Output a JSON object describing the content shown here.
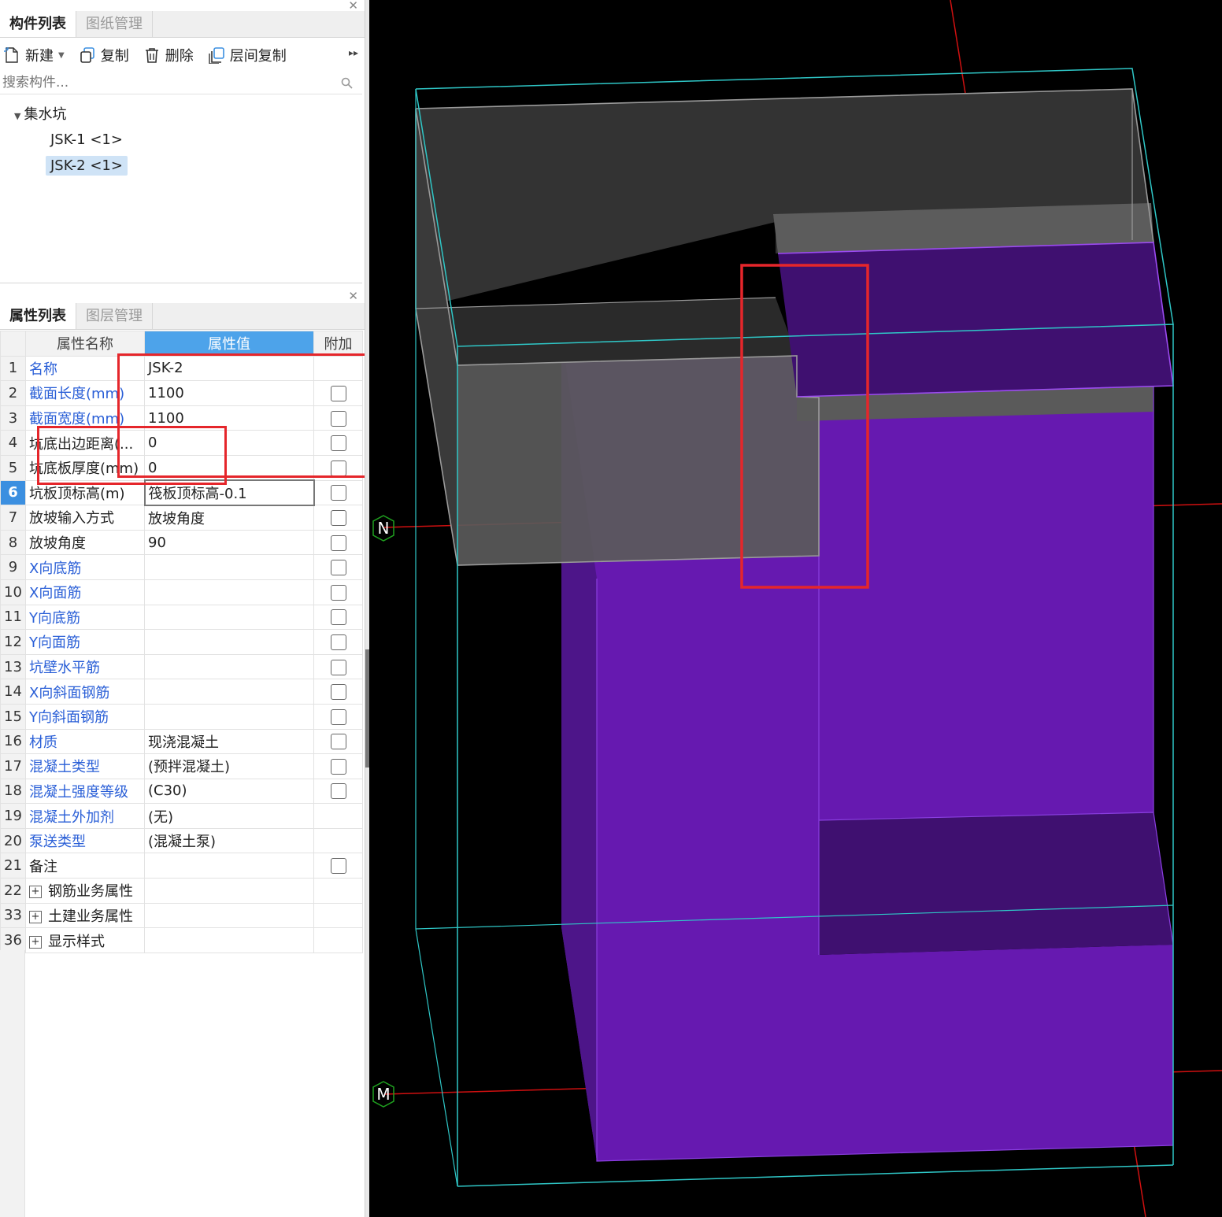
{
  "top_panel": {
    "tabs": [
      {
        "label": "构件列表",
        "active": true
      },
      {
        "label": "图纸管理",
        "active": false
      }
    ],
    "toolbar": [
      {
        "label": "新建",
        "icon": "new-file-icon",
        "has_dropdown": true
      },
      {
        "label": "复制",
        "icon": "copy-icon"
      },
      {
        "label": "删除",
        "icon": "trash-icon"
      },
      {
        "label": "层间复制",
        "icon": "layer-copy-icon"
      }
    ],
    "search_placeholder": "搜索构件...",
    "tree": {
      "category": "集水坑",
      "items": [
        {
          "label": "JSK-1 <1>",
          "selected": false
        },
        {
          "label": "JSK-2 <1>",
          "selected": true
        }
      ]
    }
  },
  "bottom_panel": {
    "tabs": [
      {
        "label": "属性列表",
        "active": true
      },
      {
        "label": "图层管理",
        "active": false
      }
    ],
    "columns": [
      "属性名称",
      "属性值",
      "附加"
    ],
    "rows": [
      {
        "num": "1",
        "name": "名称",
        "value": "JSK-2",
        "blue": true,
        "checkbox": false
      },
      {
        "num": "2",
        "name": "截面长度(mm)",
        "value": "1100",
        "blue": true,
        "checkbox": true
      },
      {
        "num": "3",
        "name": "截面宽度(mm)",
        "value": "1100",
        "blue": true,
        "checkbox": true
      },
      {
        "num": "4",
        "name": "坑底出边距离(...",
        "value": "0",
        "blue": false,
        "checkbox": true
      },
      {
        "num": "5",
        "name": "坑底板厚度(mm)",
        "value": "0",
        "blue": false,
        "checkbox": true
      },
      {
        "num": "6",
        "name": "坑板顶标高(m)",
        "value": "筏板顶标高-0.1",
        "blue": false,
        "checkbox": true,
        "selected": true
      },
      {
        "num": "7",
        "name": "放坡输入方式",
        "value": "放坡角度",
        "blue": false,
        "checkbox": true
      },
      {
        "num": "8",
        "name": "放坡角度",
        "value": "90",
        "blue": false,
        "checkbox": true
      },
      {
        "num": "9",
        "name": "X向底筋",
        "value": "",
        "blue": true,
        "checkbox": true
      },
      {
        "num": "10",
        "name": "X向面筋",
        "value": "",
        "blue": true,
        "checkbox": true
      },
      {
        "num": "11",
        "name": "Y向底筋",
        "value": "",
        "blue": true,
        "checkbox": true
      },
      {
        "num": "12",
        "name": "Y向面筋",
        "value": "",
        "blue": true,
        "checkbox": true
      },
      {
        "num": "13",
        "name": "坑壁水平筋",
        "value": "",
        "blue": true,
        "checkbox": true
      },
      {
        "num": "14",
        "name": "X向斜面钢筋",
        "value": "",
        "blue": true,
        "checkbox": true
      },
      {
        "num": "15",
        "name": "Y向斜面钢筋",
        "value": "",
        "blue": true,
        "checkbox": true
      },
      {
        "num": "16",
        "name": "材质",
        "value": "现浇混凝土",
        "blue": true,
        "checkbox": true
      },
      {
        "num": "17",
        "name": "混凝土类型",
        "value": "(预拌混凝土)",
        "blue": true,
        "checkbox": true
      },
      {
        "num": "18",
        "name": "混凝土强度等级",
        "value": "(C30)",
        "blue": true,
        "checkbox": true
      },
      {
        "num": "19",
        "name": "混凝土外加剂",
        "value": "(无)",
        "blue": true,
        "checkbox": false
      },
      {
        "num": "20",
        "name": "泵送类型",
        "value": "(混凝土泵)",
        "blue": true,
        "checkbox": false
      },
      {
        "num": "21",
        "name": "备注",
        "value": "",
        "blue": false,
        "checkbox": true
      },
      {
        "num": "22",
        "name": "钢筋业务属性",
        "value": "",
        "blue": false,
        "checkbox": false,
        "group": true
      },
      {
        "num": "33",
        "name": "土建业务属性",
        "value": "",
        "blue": false,
        "checkbox": false,
        "group": true
      },
      {
        "num": "36",
        "name": "显示样式",
        "value": "",
        "blue": false,
        "checkbox": false,
        "group": true
      }
    ]
  },
  "viewport": {
    "axis_labels": [
      "N",
      "M"
    ],
    "colors": {
      "background": "#000000",
      "pit_fill": "#6619b0",
      "raft_fill": "#8a8a8a",
      "bbox_lines": "#2fc7c7",
      "axis_lines": "#d01010",
      "annotation": "#e5262b"
    }
  }
}
